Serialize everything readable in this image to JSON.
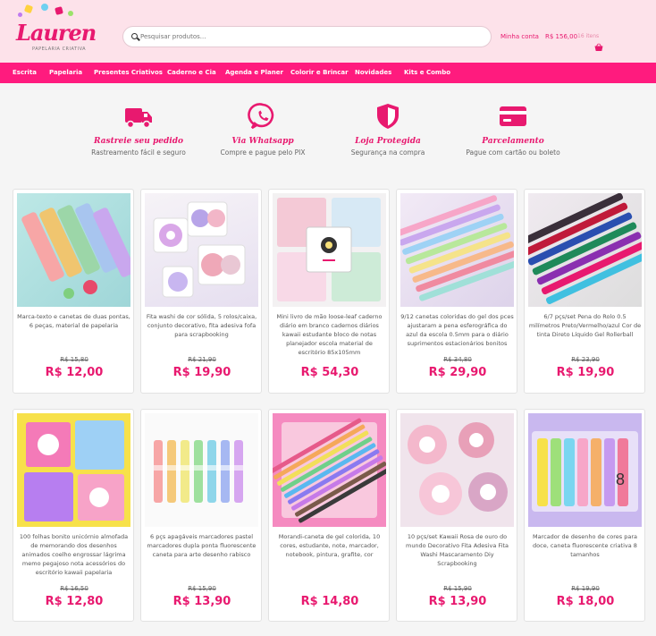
{
  "brand": {
    "logo_name": "Lauren",
    "logo_tagline": "PAPELARIA CRIATIVA"
  },
  "search": {
    "placeholder": "Pesquisar produtos..."
  },
  "account": {
    "label": "Minha conta"
  },
  "cart": {
    "total": "R$ 156,00",
    "items": "16 itens"
  },
  "nav": [
    "Escrita",
    "Papelaria",
    "Presentes Criativos",
    "Caderno e Cia",
    "Agenda e Planer",
    "Colorir e Brincar",
    "Novidades",
    "Kits e Combo"
  ],
  "features": [
    {
      "icon": "truck-icon",
      "title": "Rastreie seu pedido",
      "subtitle": "Rastreamento fácil e seguro"
    },
    {
      "icon": "whatsapp-icon",
      "title": "Via Whatsapp",
      "subtitle": "Compre e pague pelo PIX"
    },
    {
      "icon": "shield-icon",
      "title": "Loja Protegida",
      "subtitle": "Segurança na compra"
    },
    {
      "icon": "credit-card-icon",
      "title": "Parcelamento",
      "subtitle": "Pague com cartão ou boleto"
    }
  ],
  "colors": {
    "accent": "#e8196f",
    "nav_bg": "#ff1b7e",
    "header_bg": "#fde2ea"
  },
  "products": [
    {
      "title": "Marca-texto e canetas de duas pontas, 6 peças, material de papelaria",
      "old_price": "R$ 15,80",
      "price": "R$ 12,00"
    },
    {
      "title": "Fita washi de cor sólida, 5 rolos/caixa, conjunto decorativo, fita adesiva fofa para scrapbooking",
      "old_price": "R$ 21,90",
      "price": "R$ 19,90"
    },
    {
      "title": "Mini livro de mão loose-leaf caderno diário em branco cadernos diários kawaii estudante bloco de notas planejador escola material de escritório 85x105mm",
      "old_price": "",
      "price": "R$ 54,30"
    },
    {
      "title": "9/12 canetas coloridas do gel dos pces ajustaram a pena esferográfica do azul da escola 0.5mm para o diário suprimentos estacionários bonitos",
      "old_price": "R$ 34,80",
      "price": "R$ 29,90"
    },
    {
      "title": "6/7 pçs/set Pena do Rolo 0.5 milímetros Preto/Vermelho/azul Cor de tinta Direto Líquido Gel Rollerball",
      "old_price": "R$ 23,90",
      "price": "R$ 19,90"
    },
    {
      "title": "100 folhas bonito unicórnio almofada de memorando dos desenhos animados coelho engrossar lágrima memo pegajoso nota acessórios do escritório kawaii papelaria",
      "old_price": "R$ 16,50",
      "price": "R$ 12,80"
    },
    {
      "title": "6 pçs apagáveis marcadores pastel marcadores dupla ponta fluorescente caneta para arte desenho rabisco",
      "old_price": "R$ 15,90",
      "price": "R$ 13,90"
    },
    {
      "title": "Morandi-caneta de gel colorida, 10 cores, estudante, note, marcador, notebook, pintura, grafite, cor",
      "old_price": "",
      "price": "R$ 14,80"
    },
    {
      "title": "10 pçs/set Kawaii Rosa de ouro do mundo Decorativo Fita Adesiva Fita Washi Mascaramento Diy Scrapbooking",
      "old_price": "R$ 15,90",
      "price": "R$ 13,90"
    },
    {
      "title": "Marcador de desenho de cores para doce, caneta fluorescente criativa 8 tamanhos",
      "old_price": "R$ 19,90",
      "price": "R$ 18,00"
    }
  ]
}
